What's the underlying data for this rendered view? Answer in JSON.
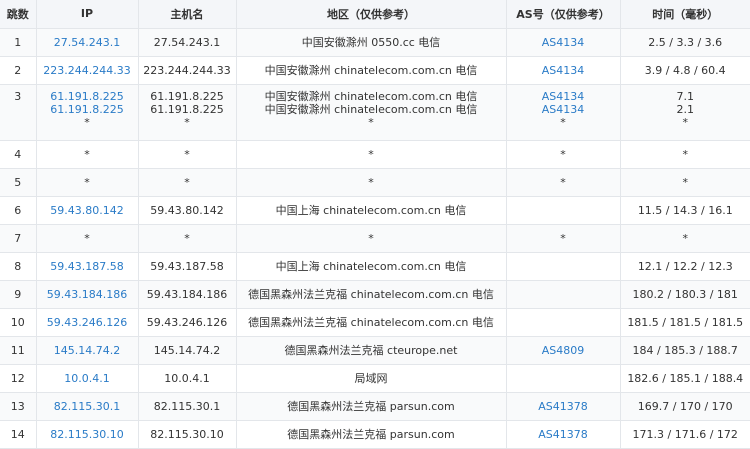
{
  "columns": {
    "hop": "跳数",
    "ip": "IP",
    "host": "主机名",
    "region": "地区（仅供参考）",
    "as": "AS号（仅供参考）",
    "time": "时间（毫秒）"
  },
  "rows": [
    {
      "hop": "1",
      "ip": [
        "27.54.243.1"
      ],
      "host": [
        "27.54.243.1"
      ],
      "region": [
        "中国安徽滁州 0550.cc 电信"
      ],
      "as": [
        "AS4134"
      ],
      "time": [
        "2.5 / 3.3 / 3.6"
      ]
    },
    {
      "hop": "2",
      "ip": [
        "223.244.244.33"
      ],
      "host": [
        "223.244.244.33"
      ],
      "region": [
        "中国安徽滁州 chinatelecom.com.cn 电信"
      ],
      "as": [
        "AS4134"
      ],
      "time": [
        "3.9 / 4.8 / 60.4"
      ]
    },
    {
      "hop": "3",
      "ip": [
        "61.191.8.225",
        "61.191.8.225",
        "*"
      ],
      "host": [
        "61.191.8.225",
        "61.191.8.225",
        "*"
      ],
      "region": [
        "中国安徽滁州 chinatelecom.com.cn 电信",
        "中国安徽滁州 chinatelecom.com.cn 电信",
        "*"
      ],
      "as": [
        "AS4134",
        "AS4134",
        "*"
      ],
      "time": [
        "7.1",
        "2.1",
        "*"
      ]
    },
    {
      "hop": "4",
      "ip": [
        "*"
      ],
      "host": [
        "*"
      ],
      "region": [
        "*"
      ],
      "as": [
        "*"
      ],
      "time": [
        "*"
      ]
    },
    {
      "hop": "5",
      "ip": [
        "*"
      ],
      "host": [
        "*"
      ],
      "region": [
        "*"
      ],
      "as": [
        "*"
      ],
      "time": [
        "*"
      ]
    },
    {
      "hop": "6",
      "ip": [
        "59.43.80.142"
      ],
      "host": [
        "59.43.80.142"
      ],
      "region": [
        "中国上海 chinatelecom.com.cn 电信"
      ],
      "as": [
        ""
      ],
      "time": [
        "11.5 / 14.3 / 16.1"
      ]
    },
    {
      "hop": "7",
      "ip": [
        "*"
      ],
      "host": [
        "*"
      ],
      "region": [
        "*"
      ],
      "as": [
        "*"
      ],
      "time": [
        "*"
      ]
    },
    {
      "hop": "8",
      "ip": [
        "59.43.187.58"
      ],
      "host": [
        "59.43.187.58"
      ],
      "region": [
        "中国上海 chinatelecom.com.cn 电信"
      ],
      "as": [
        ""
      ],
      "time": [
        "12.1 / 12.2 / 12.3"
      ]
    },
    {
      "hop": "9",
      "ip": [
        "59.43.184.186"
      ],
      "host": [
        "59.43.184.186"
      ],
      "region": [
        "德国黑森州法兰克福 chinatelecom.com.cn 电信"
      ],
      "as": [
        ""
      ],
      "time": [
        "180.2 / 180.3 / 181"
      ]
    },
    {
      "hop": "10",
      "ip": [
        "59.43.246.126"
      ],
      "host": [
        "59.43.246.126"
      ],
      "region": [
        "德国黑森州法兰克福 chinatelecom.com.cn 电信"
      ],
      "as": [
        ""
      ],
      "time": [
        "181.5 / 181.5 / 181.5"
      ]
    },
    {
      "hop": "11",
      "ip": [
        "145.14.74.2"
      ],
      "host": [
        "145.14.74.2"
      ],
      "region": [
        "德国黑森州法兰克福 cteurope.net"
      ],
      "as": [
        "AS4809"
      ],
      "time": [
        "184 / 185.3 / 188.7"
      ]
    },
    {
      "hop": "12",
      "ip": [
        "10.0.4.1"
      ],
      "host": [
        "10.0.4.1"
      ],
      "region": [
        "局域网"
      ],
      "as": [
        ""
      ],
      "time": [
        "182.6 / 185.1 / 188.4"
      ]
    },
    {
      "hop": "13",
      "ip": [
        "82.115.30.1"
      ],
      "host": [
        "82.115.30.1"
      ],
      "region": [
        "德国黑森州法兰克福 parsun.com"
      ],
      "as": [
        "AS41378"
      ],
      "time": [
        "169.7 / 170 / 170"
      ]
    },
    {
      "hop": "14",
      "ip": [
        "82.115.30.10"
      ],
      "host": [
        "82.115.30.10"
      ],
      "region": [
        "德国黑森州法兰克福 parsun.com"
      ],
      "as": [
        "AS41378"
      ],
      "time": [
        "171.3 / 171.6 / 172"
      ]
    }
  ],
  "colors": {
    "link": "#2a7bc7",
    "text": "#333333",
    "header_bg": "#f4f6f9",
    "border": "#e3e6ea"
  }
}
